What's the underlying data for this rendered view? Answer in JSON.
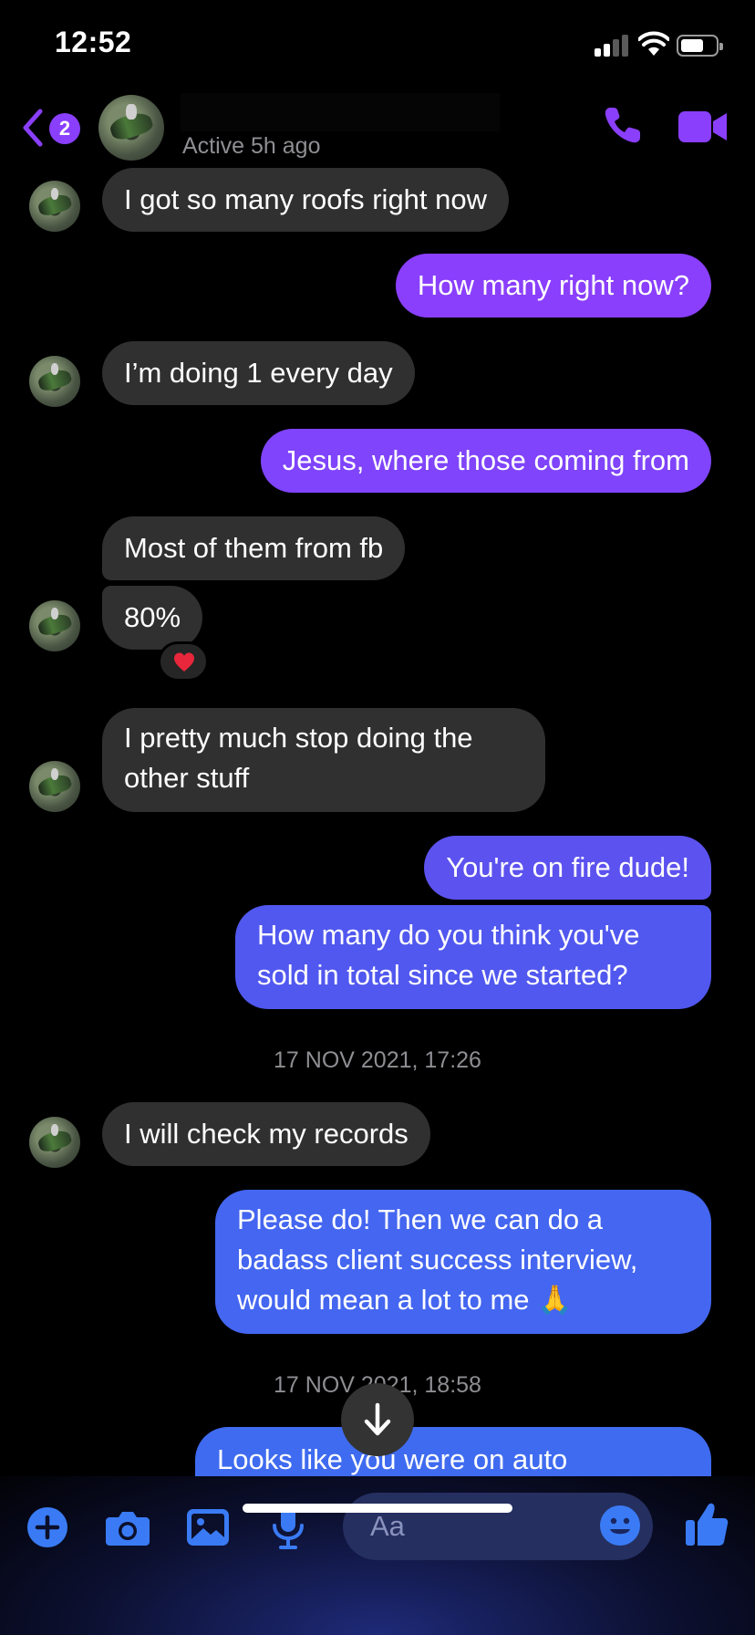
{
  "status_bar": {
    "time": "12:52"
  },
  "header": {
    "back_badge": "2",
    "active_status": "Active 5h ago",
    "accent_color": "#8a3ffc"
  },
  "messages": [
    {
      "sender": "contact",
      "text": "I got so many roofs right now"
    },
    {
      "sender": "me",
      "text": "How many right now?"
    },
    {
      "sender": "contact",
      "text": "I’m doing 1 every day"
    },
    {
      "sender": "me",
      "text": "Jesus, where those coming from"
    },
    {
      "sender": "contact",
      "text": "Most of them from fb"
    },
    {
      "sender": "contact",
      "text": "80%",
      "reaction": "heart"
    },
    {
      "sender": "contact",
      "text": "I pretty much stop doing the other stuff"
    },
    {
      "sender": "me",
      "text": "You're on fire dude!"
    },
    {
      "sender": "me",
      "text": "How many do you think you've sold in total since we started?"
    },
    {
      "sender": "contact",
      "text": "I will check my records"
    },
    {
      "sender": "me",
      "text": "Please do! Then we can do a badass client success interview, would mean a lot to me 🙏"
    },
    {
      "sender": "me",
      "text": "Looks like you were on auto"
    }
  ],
  "timestamps": [
    "17 NOV 2021, 17:26",
    "17 NOV 2021, 18:58"
  ],
  "composer": {
    "placeholder": "Aa"
  },
  "icons": {
    "back": "chevron-left-icon",
    "call": "phone-icon",
    "video": "video-camera-icon",
    "plus": "plus-circle-icon",
    "camera": "camera-icon",
    "gallery": "photo-icon",
    "mic": "microphone-icon",
    "emoji": "smiley-icon",
    "like": "thumbs-up-icon",
    "scroll": "arrow-down-icon"
  },
  "colors": {
    "incoming_bubble": "#303030",
    "outgoing_gradient": [
      "#8a3ffc",
      "#5c52ef",
      "#3f6bf0"
    ],
    "composer_icons": "#3a7bf5"
  }
}
